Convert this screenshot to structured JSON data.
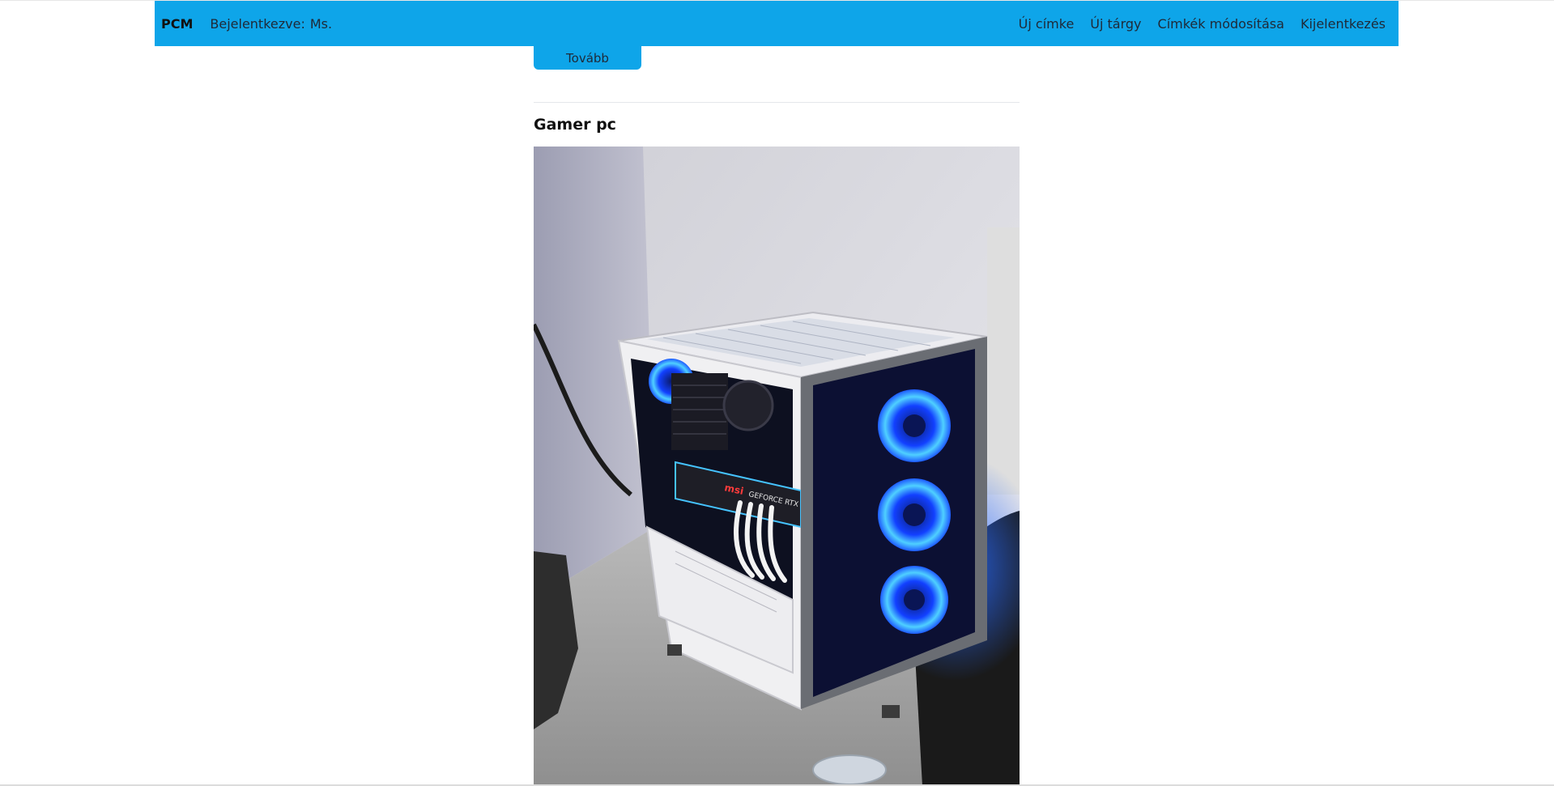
{
  "navbar": {
    "brand": "PCM",
    "login_label": "Bejelentkezve:",
    "user_name": "Ms.",
    "links": {
      "new_tag": "Új címke",
      "new_item": "Új tárgy",
      "edit_tags": "Címkék módosítása",
      "logout": "Kijelentkezés"
    }
  },
  "main": {
    "more_button": "Tovább",
    "post": {
      "title": "Gamer pc"
    }
  },
  "photo_labels": {
    "gpu_brand": "msi",
    "gpu_model": "GEFORCE RTX"
  },
  "colors": {
    "accent": "#0ea5e9",
    "fan_glow": "#1e90ff"
  }
}
